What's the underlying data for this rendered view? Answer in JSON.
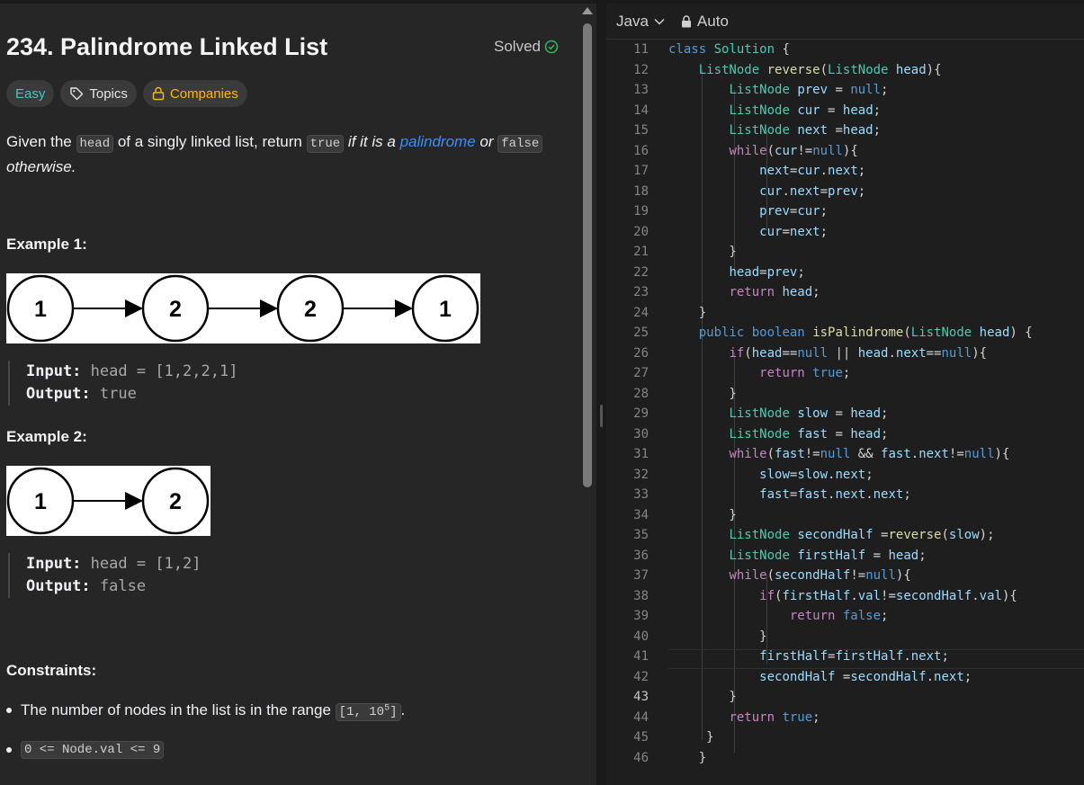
{
  "problem": {
    "title": "234. Palindrome Linked List",
    "status": "Solved",
    "tags": {
      "difficulty": "Easy",
      "topics": "Topics",
      "companies": "Companies"
    },
    "description": {
      "p1": "Given the ",
      "code_head": "head",
      "p2": " of a singly linked list, return ",
      "code_true": "true",
      "p3": " if it is a ",
      "link": "palindrome",
      "p4": " or ",
      "code_false": "false",
      "p5": "otherwise."
    },
    "examples": [
      {
        "heading": "Example 1:",
        "nodes": [
          "1",
          "2",
          "2",
          "1"
        ],
        "input_label": "Input:",
        "input_value": "head = [1,2,2,1]",
        "output_label": "Output:",
        "output_value": "true"
      },
      {
        "heading": "Example 2:",
        "nodes": [
          "1",
          "2"
        ],
        "input_label": "Input:",
        "input_value": "head = [1,2]",
        "output_label": "Output:",
        "output_value": "false"
      }
    ],
    "constraints_heading": "Constraints:",
    "constraint1_text": "The number of nodes in the list is in the range ",
    "constraint1_code": "[1, 10",
    "constraint1_sup": "5",
    "constraint1_code_end": "]",
    "constraint1_end": ".",
    "constraint2_code": "0 <= Node.val <= 9"
  },
  "editor": {
    "language": "Java",
    "mode": "Auto",
    "current_line": 43,
    "lines": [
      {
        "n": "11",
        "t": "class Solution {"
      },
      {
        "n": "12",
        "t": "    ListNode reverse(ListNode head){"
      },
      {
        "n": "13",
        "t": "        ListNode prev = null;"
      },
      {
        "n": "14",
        "t": "        ListNode cur = head;"
      },
      {
        "n": "15",
        "t": "        ListNode next =head;"
      },
      {
        "n": "16",
        "t": "        while(cur!=null){"
      },
      {
        "n": "17",
        "t": "            next=cur.next;"
      },
      {
        "n": "18",
        "t": "            cur.next=prev;"
      },
      {
        "n": "19",
        "t": "            prev=cur;"
      },
      {
        "n": "20",
        "t": "            cur=next;"
      },
      {
        "n": "21",
        "t": "        }"
      },
      {
        "n": "22",
        "t": "        head=prev;"
      },
      {
        "n": "23",
        "t": "        return head;"
      },
      {
        "n": "24",
        "t": "    }"
      },
      {
        "n": "25",
        "t": "    public boolean isPalindrome(ListNode head) {"
      },
      {
        "n": "26",
        "t": "        if(head==null || head.next==null){"
      },
      {
        "n": "27",
        "t": "            return true;"
      },
      {
        "n": "28",
        "t": "        }"
      },
      {
        "n": "29",
        "t": "        ListNode slow = head;"
      },
      {
        "n": "30",
        "t": "        ListNode fast = head;"
      },
      {
        "n": "31",
        "t": "        while(fast!=null && fast.next!=null){"
      },
      {
        "n": "32",
        "t": "            slow=slow.next;"
      },
      {
        "n": "33",
        "t": "            fast=fast.next.next;"
      },
      {
        "n": "34",
        "t": "        }"
      },
      {
        "n": "35",
        "t": "        ListNode secondHalf =reverse(slow);"
      },
      {
        "n": "36",
        "t": "        ListNode firstHalf = head;"
      },
      {
        "n": "37",
        "t": "        while(secondHalf!=null){"
      },
      {
        "n": "38",
        "t": "            if(firstHalf.val!=secondHalf.val){"
      },
      {
        "n": "39",
        "t": "                return false;"
      },
      {
        "n": "40",
        "t": "            }"
      },
      {
        "n": "41",
        "t": "            firstHalf=firstHalf.next;"
      },
      {
        "n": "42",
        "t": "            secondHalf =secondHalf.next;"
      },
      {
        "n": "43",
        "t": "        }"
      },
      {
        "n": "44",
        "t": "        return true;"
      },
      {
        "n": "45",
        "t": "     }"
      },
      {
        "n": "46",
        "t": "    }"
      }
    ]
  }
}
